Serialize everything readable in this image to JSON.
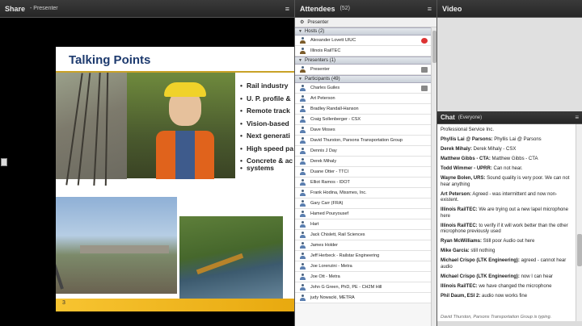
{
  "share": {
    "title": "Share",
    "subtitle": "- Presenter",
    "menu_icon": "menu-icon",
    "slide": {
      "title": "Talking Points",
      "bullets": [
        "Rail industry",
        "U. P. profile &",
        "Remote track",
        "Vision-based",
        "Next generati",
        "High speed pa",
        "Concrete & ac",
        "systems"
      ],
      "page_number": "3"
    }
  },
  "attendees": {
    "title": "Attendees",
    "count": "(52)",
    "role_bar": "Presenter",
    "sections": {
      "hosts": "Hosts (2)",
      "presenters": "Presenters (1)",
      "participants": "Participants (49)"
    },
    "hosts": [
      "Alexander Lovett UIUC",
      "Illinois RailTEC"
    ],
    "presenters": [
      "Presenter"
    ],
    "participants": [
      "Charles Guiles",
      "Art Peterson",
      "Bradley Randall-Hanson",
      "Craig Sollenberger - CSX",
      "Dave Moses",
      "David Thurston, Parsons Transportation Group",
      "Dennis J Day",
      "Derek Mihaly",
      "Duane Otter - TTCI",
      "Elliot Ramos - IDOT",
      "Frank Hodina, Missmes, Inc.",
      "Gary Carr (FRA)",
      "Hamed Pouryousef",
      "Hart",
      "Jack Chislett, Rail Sciences",
      "James Holder",
      "Jeff Herbeck - Railstar Engineering",
      "Joe Lorenzini - Metra",
      "Joe Ott - Metra",
      "John G Green, PhD, PE - CH2M Hill",
      "judy Nowacki, METRA"
    ]
  },
  "video": {
    "title": "Video"
  },
  "chat": {
    "title": "Chat",
    "scope": "(Everyone)",
    "messages": [
      {
        "who": "",
        "text": "Professional Service Inc."
      },
      {
        "who": "Phyllis Lai @ Parsons:",
        "text": " Phyllis Lai @ Parsons"
      },
      {
        "who": "Derek Mihaly:",
        "text": " Derek Mihaly - CSX"
      },
      {
        "who": "Matthew Gibbs - CTA:",
        "text": " Matthew Gibbs - CTA"
      },
      {
        "who": "Todd Wimmer - UPRR:",
        "text": " Can not hear."
      },
      {
        "who": "Wayne Bolen, URS:",
        "text": " Sound quality is very poor. We can not hear anything"
      },
      {
        "who": "Art Peterson:",
        "text": " Agreed - was intermittent and now non-existent."
      },
      {
        "who": "Illinois RailTEC:",
        "text": " We are trying out a new lapel microphone here"
      },
      {
        "who": "Illinois RailTEC:",
        "text": " to verify if it will work better than the other microphone previously used"
      },
      {
        "who": "Ryan McWilliams:",
        "text": " Still poor Audio out here"
      },
      {
        "who": "Mike Garcia:",
        "text": " still nothing"
      },
      {
        "who": "Michael Crispo (LTK Engineering):",
        "text": " agreed - cannot hear audio"
      },
      {
        "who": "Michael Crispo (LTK Engineering):",
        "text": " now I can hear"
      },
      {
        "who": "Illinois RailTEC:",
        "text": " we have changed the microphone"
      },
      {
        "who": "Phil Daum, ESI 2:",
        "text": " audio now works fine"
      }
    ],
    "typing": "David Thurston, Parsons Transportation Group is typing."
  }
}
